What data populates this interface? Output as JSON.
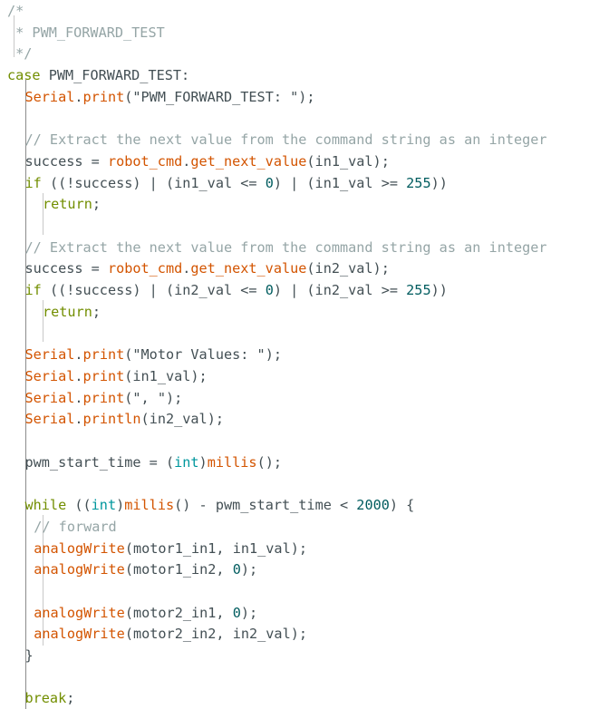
{
  "editor": {
    "lines": [
      {
        "indent": 0,
        "tokens": [
          {
            "t": "cm",
            "v": "/*"
          }
        ]
      },
      {
        "indent": 0,
        "tokens": [
          {
            "t": "cm",
            "v": " * PWM_FORWARD_TEST"
          }
        ]
      },
      {
        "indent": 0,
        "tokens": [
          {
            "t": "cm",
            "v": " */"
          }
        ]
      },
      {
        "indent": 0,
        "tokens": [
          {
            "t": "kw",
            "v": "case"
          },
          {
            "t": "tx",
            "v": " PWM_FORWARD_TEST:"
          }
        ]
      },
      {
        "indent": 2,
        "tokens": [
          {
            "t": "fn",
            "v": "Serial"
          },
          {
            "t": "tx",
            "v": "."
          },
          {
            "t": "fn",
            "v": "print"
          },
          {
            "t": "tx",
            "v": "(\"PWM_FORWARD_TEST: \");"
          }
        ]
      },
      {
        "indent": 2,
        "tokens": []
      },
      {
        "indent": 2,
        "tokens": [
          {
            "t": "cm",
            "v": "// Extract the next value from the command string as an integer"
          }
        ]
      },
      {
        "indent": 2,
        "tokens": [
          {
            "t": "tx",
            "v": "success = "
          },
          {
            "t": "fn",
            "v": "robot_cmd"
          },
          {
            "t": "tx",
            "v": "."
          },
          {
            "t": "fn",
            "v": "get_next_value"
          },
          {
            "t": "tx",
            "v": "(in1_val);"
          }
        ]
      },
      {
        "indent": 2,
        "tokens": [
          {
            "t": "kw",
            "v": "if"
          },
          {
            "t": "tx",
            "v": " ((!success) | (in1_val <= "
          },
          {
            "t": "num",
            "v": "0"
          },
          {
            "t": "tx",
            "v": ") | (in1_val >= "
          },
          {
            "t": "num",
            "v": "255"
          },
          {
            "t": "tx",
            "v": "))"
          }
        ]
      },
      {
        "indent": 4,
        "tokens": [
          {
            "t": "kw",
            "v": "return"
          },
          {
            "t": "tx",
            "v": ";"
          }
        ]
      },
      {
        "indent": 2,
        "tokens": []
      },
      {
        "indent": 2,
        "tokens": [
          {
            "t": "cm",
            "v": "// Extract the next value from the command string as an integer"
          }
        ]
      },
      {
        "indent": 2,
        "tokens": [
          {
            "t": "tx",
            "v": "success = "
          },
          {
            "t": "fn",
            "v": "robot_cmd"
          },
          {
            "t": "tx",
            "v": "."
          },
          {
            "t": "fn",
            "v": "get_next_value"
          },
          {
            "t": "tx",
            "v": "(in2_val);"
          }
        ]
      },
      {
        "indent": 2,
        "tokens": [
          {
            "t": "kw",
            "v": "if"
          },
          {
            "t": "tx",
            "v": " ((!success) | (in2_val <= "
          },
          {
            "t": "num",
            "v": "0"
          },
          {
            "t": "tx",
            "v": ") | (in2_val >= "
          },
          {
            "t": "num",
            "v": "255"
          },
          {
            "t": "tx",
            "v": "))"
          }
        ]
      },
      {
        "indent": 4,
        "tokens": [
          {
            "t": "kw",
            "v": "return"
          },
          {
            "t": "tx",
            "v": ";"
          }
        ]
      },
      {
        "indent": 2,
        "tokens": []
      },
      {
        "indent": 2,
        "tokens": [
          {
            "t": "fn",
            "v": "Serial"
          },
          {
            "t": "tx",
            "v": "."
          },
          {
            "t": "fn",
            "v": "print"
          },
          {
            "t": "tx",
            "v": "(\"Motor Values: \");"
          }
        ]
      },
      {
        "indent": 2,
        "tokens": [
          {
            "t": "fn",
            "v": "Serial"
          },
          {
            "t": "tx",
            "v": "."
          },
          {
            "t": "fn",
            "v": "print"
          },
          {
            "t": "tx",
            "v": "(in1_val);"
          }
        ]
      },
      {
        "indent": 2,
        "tokens": [
          {
            "t": "fn",
            "v": "Serial"
          },
          {
            "t": "tx",
            "v": "."
          },
          {
            "t": "fn",
            "v": "print"
          },
          {
            "t": "tx",
            "v": "(\", \");"
          }
        ]
      },
      {
        "indent": 2,
        "tokens": [
          {
            "t": "fn",
            "v": "Serial"
          },
          {
            "t": "tx",
            "v": "."
          },
          {
            "t": "fn",
            "v": "println"
          },
          {
            "t": "tx",
            "v": "(in2_val);"
          }
        ]
      },
      {
        "indent": 2,
        "tokens": []
      },
      {
        "indent": 2,
        "tokens": [
          {
            "t": "tx",
            "v": "pwm_start_time = ("
          },
          {
            "t": "ty",
            "v": "int"
          },
          {
            "t": "tx",
            "v": ")"
          },
          {
            "t": "fn",
            "v": "millis"
          },
          {
            "t": "tx",
            "v": "();"
          }
        ]
      },
      {
        "indent": 2,
        "tokens": []
      },
      {
        "indent": 2,
        "tokens": [
          {
            "t": "kw",
            "v": "while"
          },
          {
            "t": "tx",
            "v": " (("
          },
          {
            "t": "ty",
            "v": "int"
          },
          {
            "t": "tx",
            "v": ")"
          },
          {
            "t": "fn",
            "v": "millis"
          },
          {
            "t": "tx",
            "v": "() - pwm_start_time < "
          },
          {
            "t": "num",
            "v": "2000"
          },
          {
            "t": "tx",
            "v": ") {"
          }
        ]
      },
      {
        "indent": 3,
        "tokens": [
          {
            "t": "cm",
            "v": "// forward"
          }
        ]
      },
      {
        "indent": 3,
        "tokens": [
          {
            "t": "fn",
            "v": "analogWrite"
          },
          {
            "t": "tx",
            "v": "(motor1_in1, in1_val);"
          }
        ]
      },
      {
        "indent": 3,
        "tokens": [
          {
            "t": "fn",
            "v": "analogWrite"
          },
          {
            "t": "tx",
            "v": "(motor1_in2, "
          },
          {
            "t": "num",
            "v": "0"
          },
          {
            "t": "tx",
            "v": ");"
          }
        ]
      },
      {
        "indent": 3,
        "tokens": []
      },
      {
        "indent": 3,
        "tokens": [
          {
            "t": "fn",
            "v": "analogWrite"
          },
          {
            "t": "tx",
            "v": "(motor2_in1, "
          },
          {
            "t": "num",
            "v": "0"
          },
          {
            "t": "tx",
            "v": ");"
          }
        ]
      },
      {
        "indent": 3,
        "tokens": [
          {
            "t": "fn",
            "v": "analogWrite"
          },
          {
            "t": "tx",
            "v": "(motor2_in2, in2_val);"
          }
        ]
      },
      {
        "indent": 2,
        "tokens": [
          {
            "t": "tx",
            "v": "}"
          }
        ]
      },
      {
        "indent": 2,
        "tokens": []
      },
      {
        "indent": 2,
        "tokens": [
          {
            "t": "kw",
            "v": "break"
          },
          {
            "t": "tx",
            "v": ";"
          }
        ]
      }
    ]
  }
}
